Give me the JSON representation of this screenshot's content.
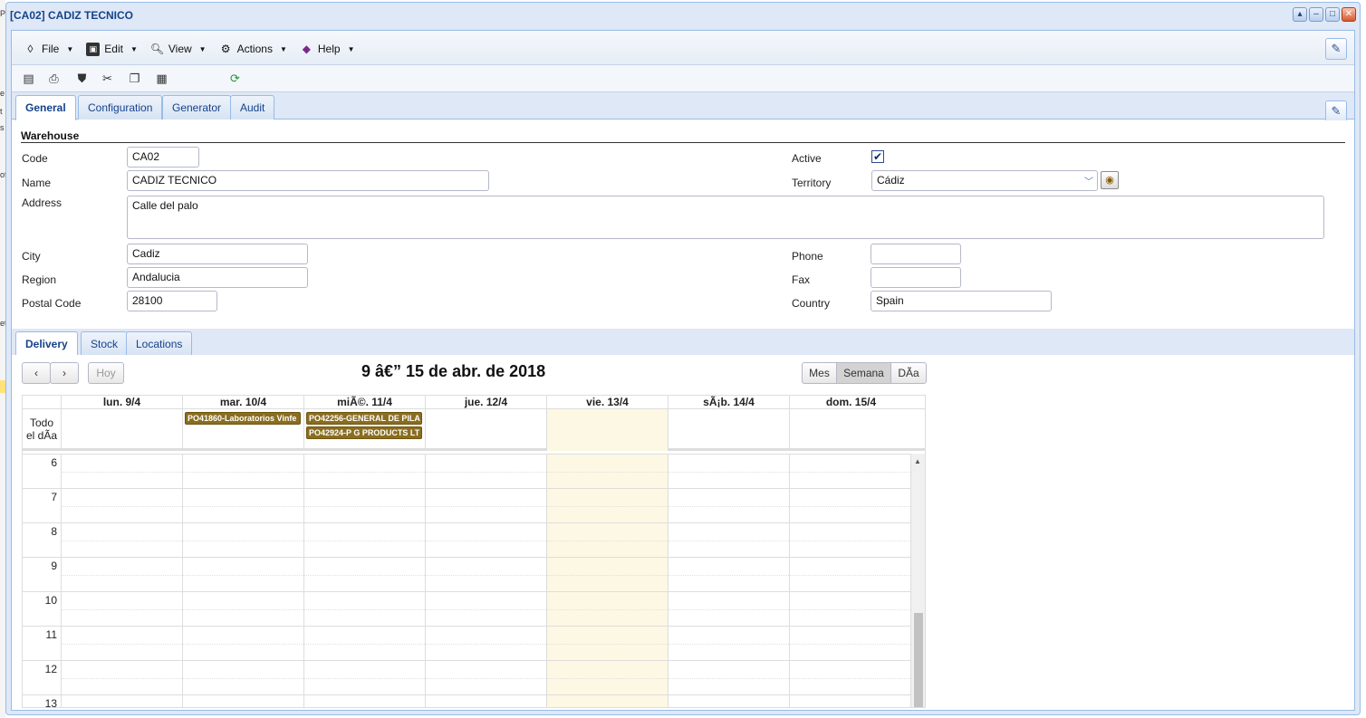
{
  "window": {
    "title": "[CA02] CADIZ TECNICO"
  },
  "menu": {
    "items": [
      {
        "label": "File",
        "icon": "file-icon"
      },
      {
        "label": "Edit",
        "icon": "edit-icon"
      },
      {
        "label": "View",
        "icon": "view-icon"
      },
      {
        "label": "Actions",
        "icon": "actions-icon"
      },
      {
        "label": "Help",
        "icon": "help-icon"
      }
    ]
  },
  "top_tabs": [
    "General",
    "Configuration",
    "Generator",
    "Audit"
  ],
  "form": {
    "section_title": "Warehouse",
    "code_label": "Code",
    "code": "CA02",
    "name_label": "Name",
    "name": "CADIZ TECNICO",
    "address_label": "Address",
    "address": "Calle del palo",
    "city_label": "City",
    "city": "Cadiz",
    "region_label": "Region",
    "region": "Andalucia",
    "postal_label": "Postal Code",
    "postal": "28100",
    "active_label": "Active",
    "active": "✔",
    "territory_label": "Territory",
    "territory": "Cádiz",
    "phone_label": "Phone",
    "phone": "",
    "fax_label": "Fax",
    "fax": "",
    "country_label": "Country",
    "country": "Spain"
  },
  "bottom_tabs": [
    "Delivery",
    "Stock",
    "Locations"
  ],
  "calendar": {
    "prev": "‹",
    "next": "›",
    "today": "Hoy",
    "title": "9 â€” 15 de abr. de 2018",
    "views": [
      "Mes",
      "Semana",
      "DÃa"
    ],
    "allday_label_1": "Todo",
    "allday_label_2": "el dÃa",
    "days": [
      "lun. 9/4",
      "mar. 10/4",
      "miÃ©. 11/4",
      "jue. 12/4",
      "vie. 13/4",
      "sÃ¡b. 14/4",
      "dom. 15/4"
    ],
    "events": [
      {
        "day": "mar. 10/4",
        "label": "PO41860-Laboratorios Vinfe"
      },
      {
        "day": "miÃ©. 11/4",
        "label": "PO42256-GENERAL DE PILA"
      },
      {
        "day": "miÃ©. 11/4",
        "label": "PO42924-P G PRODUCTS LT"
      }
    ],
    "hours": [
      "6",
      "7",
      "8",
      "9",
      "10",
      "11",
      "12",
      "13"
    ]
  }
}
